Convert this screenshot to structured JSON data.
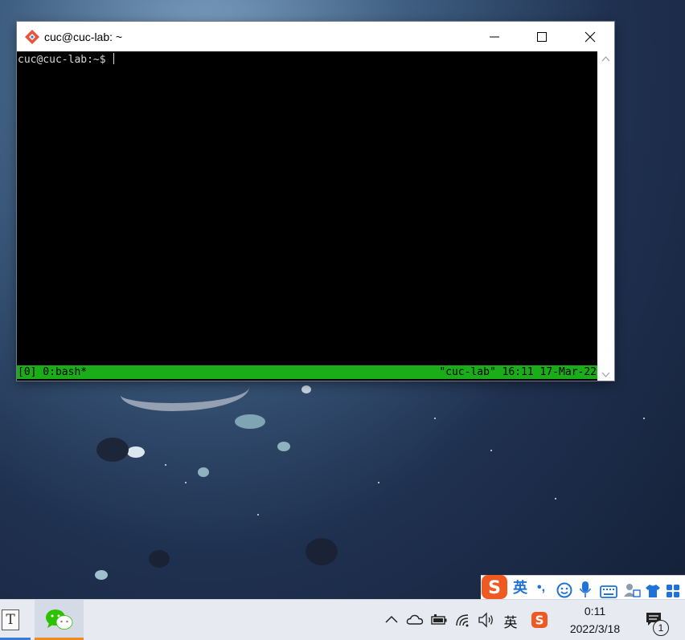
{
  "window": {
    "title": "cuc@cuc-lab: ~",
    "minimize_icon": "minimize-icon",
    "maximize_icon": "maximize-icon",
    "close_icon": "close-icon"
  },
  "terminal": {
    "prompt": "cuc@cuc-lab:~$ ",
    "status_left": "[0] 0:bash*",
    "status_right": "\"cuc-lab\" 16:11 17-Mar-22",
    "status_color": "#1aad19"
  },
  "ime": {
    "logo": "sogou-logo-icon",
    "mode": "英",
    "punct": "•,",
    "items": [
      "emoji-icon",
      "microphone-icon",
      "keyboard-icon",
      "user-icon",
      "skin-shirt-icon",
      "toolbox-grid-icon"
    ]
  },
  "taskbar": {
    "apps": [
      "typora-app-icon",
      "wechat-app-icon"
    ],
    "tray": {
      "ime_mode": "英",
      "time": "0:11",
      "date": "2022/3/18",
      "notification_count": "1"
    }
  },
  "colors": {
    "sogou": "#f05a22",
    "ime_blue": "#1e72d8"
  }
}
